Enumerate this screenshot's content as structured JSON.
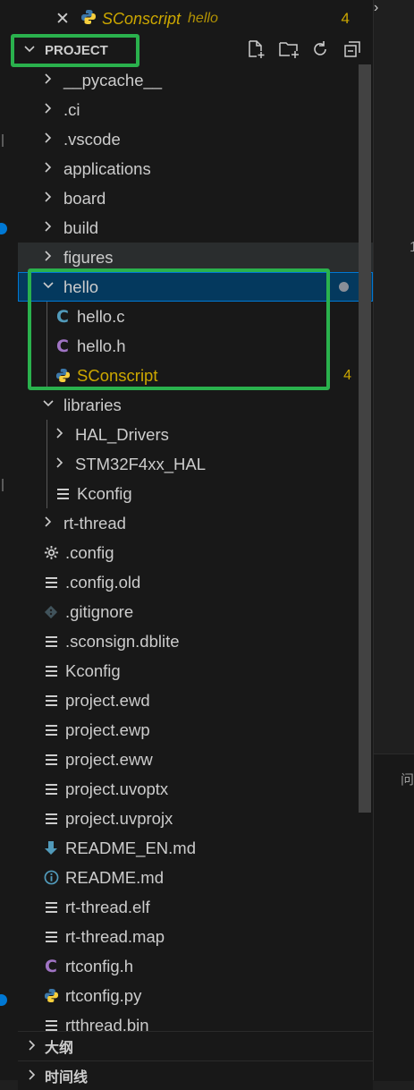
{
  "open_editor": {
    "close_glyph": "✕",
    "name": "SConscript",
    "description": "hello",
    "problems": "4"
  },
  "explorer": {
    "section_title": "PROJECT",
    "toolbar": [
      "new-file-icon",
      "new-folder-icon",
      "refresh-icon",
      "collapse-all-icon"
    ]
  },
  "tree": [
    {
      "label": "__pycache__",
      "type": "folder",
      "expanded": false
    },
    {
      "label": ".ci",
      "type": "folder",
      "expanded": false
    },
    {
      "label": ".vscode",
      "type": "folder",
      "expanded": false
    },
    {
      "label": "applications",
      "type": "folder",
      "expanded": false
    },
    {
      "label": "board",
      "type": "folder",
      "expanded": false
    },
    {
      "label": "build",
      "type": "folder",
      "expanded": false
    },
    {
      "label": "figures",
      "type": "folder",
      "expanded": false
    },
    {
      "label": "hello",
      "type": "folder",
      "expanded": true,
      "selected": true
    },
    {
      "label": "hello.c",
      "type": "c-file"
    },
    {
      "label": "hello.h",
      "type": "h-file"
    },
    {
      "label": "SConscript",
      "type": "python-file",
      "problems": "4"
    },
    {
      "label": "libraries",
      "type": "folder",
      "expanded": true
    },
    {
      "label": "HAL_Drivers",
      "type": "folder",
      "expanded": false
    },
    {
      "label": "STM32F4xx_HAL",
      "type": "folder",
      "expanded": false
    },
    {
      "label": "Kconfig",
      "type": "text-file"
    },
    {
      "label": "rt-thread",
      "type": "folder",
      "expanded": false
    },
    {
      "label": ".config",
      "type": "config-file"
    },
    {
      "label": ".config.old",
      "type": "text-file"
    },
    {
      "label": ".gitignore",
      "type": "git-file"
    },
    {
      "label": ".sconsign.dblite",
      "type": "text-file"
    },
    {
      "label": "Kconfig",
      "type": "text-file"
    },
    {
      "label": "project.ewd",
      "type": "text-file"
    },
    {
      "label": "project.ewp",
      "type": "text-file"
    },
    {
      "label": "project.eww",
      "type": "text-file"
    },
    {
      "label": "project.uvoptx",
      "type": "text-file"
    },
    {
      "label": "project.uvprojx",
      "type": "text-file"
    },
    {
      "label": "README_EN.md",
      "type": "markdown-download-file"
    },
    {
      "label": "README.md",
      "type": "markdown-info-file"
    },
    {
      "label": "rt-thread.elf",
      "type": "text-file"
    },
    {
      "label": "rt-thread.map",
      "type": "text-file"
    },
    {
      "label": "rtconfig.h",
      "type": "h-file"
    },
    {
      "label": "rtconfig.py",
      "type": "python-file"
    },
    {
      "label": "rtthread.bin",
      "type": "text-file"
    }
  ],
  "sections": {
    "outline": "大纲",
    "timeline": "时间线"
  },
  "editor": {
    "line_number": "1",
    "panel_tab": "问"
  },
  "colors": {
    "annotation": "#2ab14d",
    "selection": "#04395e",
    "warning": "#cca700"
  }
}
